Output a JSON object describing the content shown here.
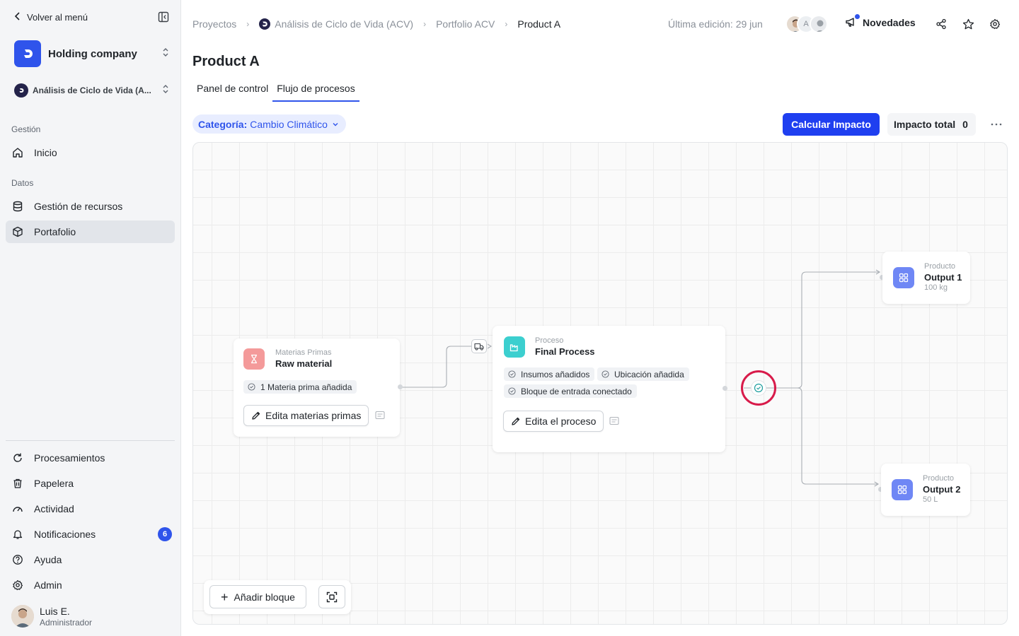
{
  "sidebar": {
    "back_label": "Volver al menú",
    "company_name": "Holding company",
    "project_name": "Análisis de Ciclo de Vida (A...",
    "sections": {
      "gestion": "Gestión",
      "datos": "Datos"
    },
    "items": {
      "inicio": "Inicio",
      "recursos": "Gestión de recursos",
      "portafolio": "Portafolio",
      "procesamientos": "Procesamientos",
      "papelera": "Papelera",
      "actividad": "Actividad",
      "notificaciones": "Notificaciones",
      "ayuda": "Ayuda",
      "admin": "Admin"
    },
    "notifications_count": "6",
    "user": {
      "name": "Luis E.",
      "role": "Administrador"
    }
  },
  "header": {
    "breadcrumb": [
      "Proyectos",
      "Análisis de Ciclo de Vida (ACV)",
      "Portfolio ACV",
      "Product A"
    ],
    "last_edit": "Última edición: 29 jun",
    "avatar_initial": "A",
    "news_label": "Novedades"
  },
  "page": {
    "title": "Product A",
    "tabs": [
      "Panel de control",
      "Flujo de procesos"
    ],
    "active_tab": 1
  },
  "toolbar": {
    "category_label": "Categoría:",
    "category_value": "Cambio Climático",
    "calc_label": "Calcular Impacto",
    "total_label": "Impacto total",
    "total_value": "0"
  },
  "nodes": {
    "raw": {
      "subtitle": "Materias Primas",
      "title": "Raw material",
      "chip": "1 Materia prima añadida",
      "button": "Edita materias primas"
    },
    "process": {
      "subtitle": "Proceso",
      "title": "Final Process",
      "chips": [
        "Insumos añadidos",
        "Ubicación añadida",
        "Bloque de entrada conectado"
      ],
      "button": "Edita el proceso"
    },
    "output1": {
      "subtitle": "Producto",
      "title": "Output 1",
      "meta": "100 kg"
    },
    "output2": {
      "subtitle": "Producto",
      "title": "Output 2",
      "meta": "50 L"
    }
  },
  "canvas_toolbar": {
    "add_label": "Añadir bloque"
  },
  "colors": {
    "accent": "#2f54eb",
    "raw_icon": "#f49a9a",
    "process_icon": "#3ccfcf",
    "product_icon": "#6f87f5",
    "highlight_ring": "#d81b4a"
  }
}
